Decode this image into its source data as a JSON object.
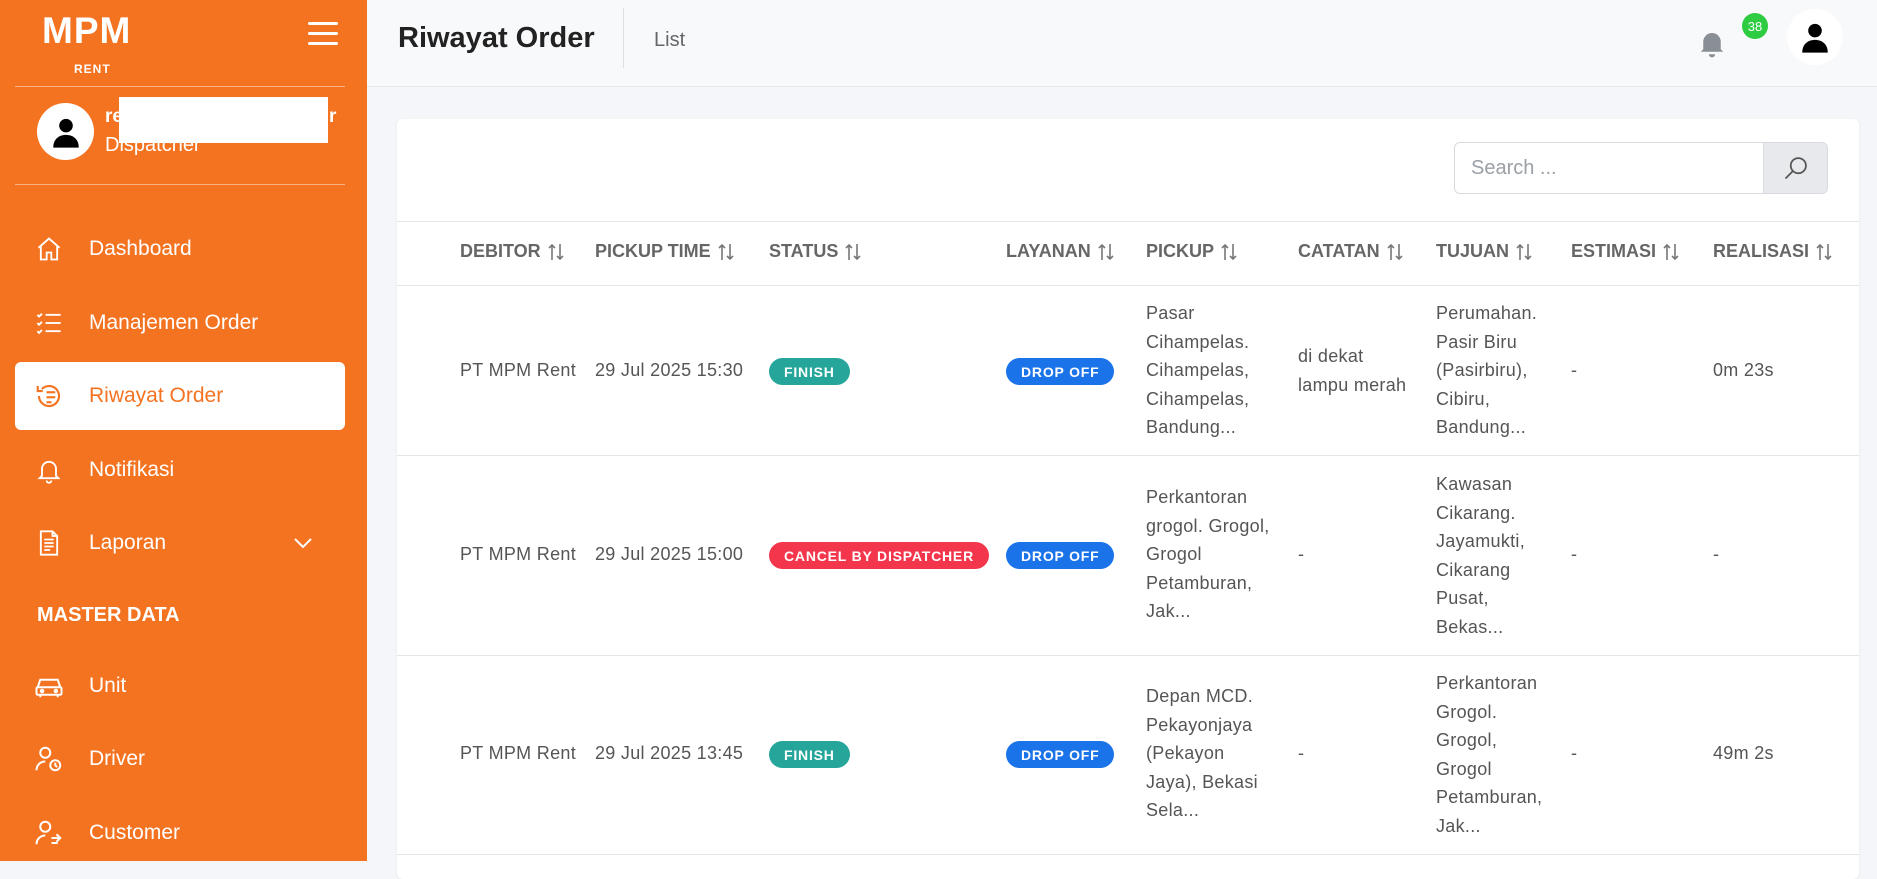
{
  "brand": {
    "logo": "MPM",
    "sub": "RENT"
  },
  "profile": {
    "name": "re",
    "name_tail": "r",
    "role": "Dispatcher"
  },
  "sidebar": {
    "items": [
      {
        "label": "Dashboard",
        "icon": "home-icon"
      },
      {
        "label": "Manajemen Order",
        "icon": "list-icon"
      },
      {
        "label": "Riwayat Order",
        "icon": "history-icon",
        "active": true
      },
      {
        "label": "Notifikasi",
        "icon": "bell-icon"
      },
      {
        "label": "Laporan",
        "icon": "report-icon"
      }
    ],
    "section": "MASTER DATA",
    "master_items": [
      {
        "label": "Unit",
        "icon": "car-icon"
      },
      {
        "label": "Driver",
        "icon": "driver-icon"
      },
      {
        "label": "Customer",
        "icon": "customer-icon"
      }
    ]
  },
  "header": {
    "title": "Riwayat Order",
    "breadcrumb": "List",
    "notification_count": "38"
  },
  "search": {
    "placeholder": "Search ..."
  },
  "table": {
    "columns": [
      "DEBITOR",
      "PICKUP TIME",
      "STATUS",
      "LAYANAN",
      "PICKUP",
      "CATATAN",
      "TUJUAN",
      "ESTIMASI",
      "REALISASI"
    ],
    "rows": [
      {
        "debitor": "PT MPM Rent",
        "pickup_time": "29 Jul 2025 15:30",
        "status": "FINISH",
        "layanan": "DROP OFF",
        "pickup": [
          "Pasar",
          "Cihampelas.",
          "Cihampelas,",
          "Cihampelas,",
          "Bandung..."
        ],
        "catatan": [
          "di dekat",
          "lampu merah"
        ],
        "tujuan": [
          "Perumahan.",
          "Pasir Biru",
          "(Pasirbiru),",
          "Cibiru,",
          "Bandung..."
        ],
        "estimasi": "-",
        "realisasi": "0m 23s"
      },
      {
        "debitor": "PT MPM Rent",
        "pickup_time": "29 Jul 2025 15:00",
        "status": "CANCEL BY DISPATCHER",
        "layanan": "DROP OFF",
        "pickup": [
          "Perkantoran",
          "grogol. Grogol,",
          "Grogol",
          "Petamburan,",
          "Jak..."
        ],
        "catatan": [
          "-"
        ],
        "tujuan": [
          "Kawasan",
          "Cikarang.",
          "Jayamukti,",
          "Cikarang",
          "Pusat,",
          "Bekas..."
        ],
        "estimasi": "-",
        "realisasi": "-"
      },
      {
        "debitor": "PT MPM Rent",
        "pickup_time": "29 Jul 2025 13:45",
        "status": "FINISH",
        "layanan": "DROP OFF",
        "pickup": [
          "Depan MCD.",
          "Pekayonjaya",
          "(Pekayon",
          "Jaya), Bekasi",
          "Sela..."
        ],
        "catatan": [
          "-"
        ],
        "tujuan": [
          "Perkantoran",
          "Grogol.",
          "Grogol,",
          "Grogol",
          "Petamburan,",
          "Jak..."
        ],
        "estimasi": "-",
        "realisasi": "49m 2s"
      }
    ]
  },
  "colors": {
    "brand": "#f37321",
    "finish": "#26a69a",
    "cancel": "#f4364c",
    "drop_off": "#1a73e8",
    "badge_green": "#2ecc40"
  }
}
